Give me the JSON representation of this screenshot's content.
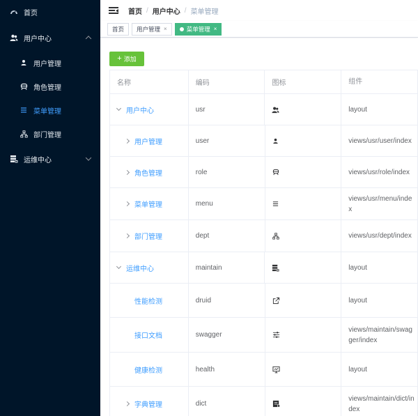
{
  "sidebar": {
    "items": [
      {
        "label": "首页",
        "icon": "dashboard-icon"
      },
      {
        "label": "用户中心",
        "icon": "peoples-icon",
        "expanded": true
      },
      {
        "label": "用户管理",
        "icon": "user-icon"
      },
      {
        "label": "角色管理",
        "icon": "role-icon"
      },
      {
        "label": "菜单管理",
        "icon": "menu-list-icon",
        "active": true
      },
      {
        "label": "部门管理",
        "icon": "tree-icon"
      },
      {
        "label": "运维中心",
        "icon": "server-icon",
        "expanded": false
      }
    ],
    "active_color": "#409eff",
    "bg_color": "#001529"
  },
  "navbar": {
    "breadcrumb": [
      "首页",
      "用户中心",
      "菜单管理"
    ]
  },
  "tags": [
    {
      "label": "首页",
      "closable": false,
      "active": false
    },
    {
      "label": "用户管理",
      "closable": true,
      "active": false
    },
    {
      "label": "菜单管理",
      "closable": true,
      "active": true
    }
  ],
  "tag_close_glyph": "×",
  "toolbar": {
    "add_label": "添加",
    "add_color": "#67c23a"
  },
  "table": {
    "headers": [
      "名称",
      "编码",
      "图标",
      "组件"
    ],
    "rows": [
      {
        "name": "用户中心",
        "code": "usr",
        "icon": "peoples-icon",
        "component": "layout",
        "expand": "open"
      },
      {
        "name": "用户管理",
        "code": "user",
        "icon": "user-icon",
        "component": "views/usr/user/index",
        "expand": "closed"
      },
      {
        "name": "角色管理",
        "code": "role",
        "icon": "role-icon",
        "component": "views/usr/role/index",
        "expand": "closed"
      },
      {
        "name": "菜单管理",
        "code": "menu",
        "icon": "menu-list-icon",
        "component": "views/usr/menu/index",
        "expand": "closed"
      },
      {
        "name": "部门管理",
        "code": "dept",
        "icon": "tree-icon",
        "component": "views/usr/dept/index",
        "expand": "closed"
      },
      {
        "name": "运维中心",
        "code": "maintain",
        "icon": "server-icon",
        "component": "layout",
        "expand": "open"
      },
      {
        "name": "性能检测",
        "code": "druid",
        "icon": "external-link-icon",
        "component": "layout",
        "expand": "none"
      },
      {
        "name": "接口文档",
        "code": "swagger",
        "icon": "sliders-icon",
        "component": "views/maintain/swagger/index",
        "expand": "none"
      },
      {
        "name": "健康检测",
        "code": "health",
        "icon": "monitor-icon",
        "component": "layout",
        "expand": "none"
      },
      {
        "name": "字典管理",
        "code": "dict",
        "icon": "dictionary-icon",
        "component": "views/maintain/dict/index",
        "expand": "closed"
      }
    ]
  },
  "tag_active_color": "#42b983",
  "link_color": "#409eff"
}
